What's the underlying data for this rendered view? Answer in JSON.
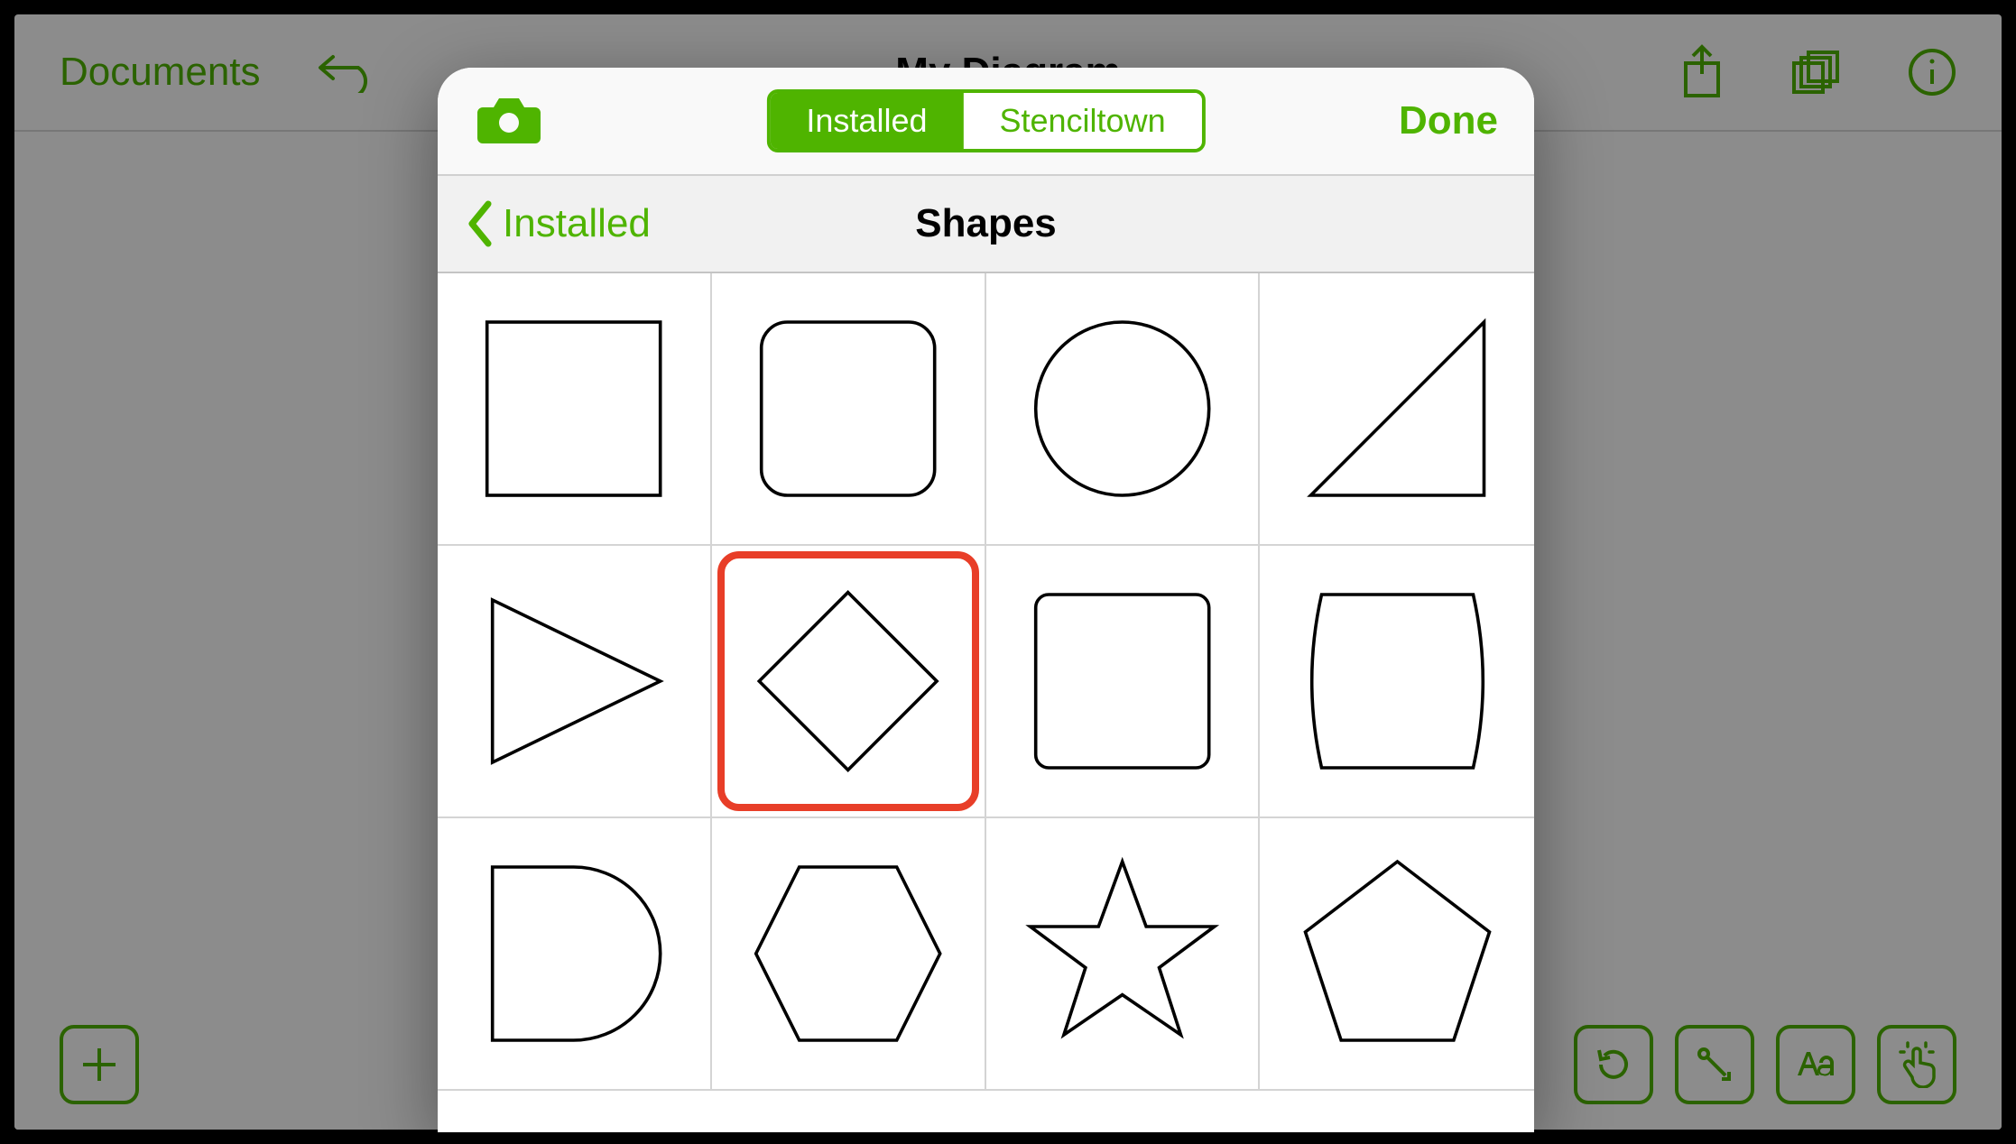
{
  "header": {
    "documents_label": "Documents",
    "document_title": "My Diagram"
  },
  "popover": {
    "segments": {
      "installed": "Installed",
      "stenciltown": "Stenciltown",
      "active": "installed"
    },
    "done_label": "Done",
    "back_label": "Installed",
    "title": "Shapes",
    "shapes": [
      {
        "name": "square"
      },
      {
        "name": "rounded-rectangle"
      },
      {
        "name": "circle"
      },
      {
        "name": "right-triangle"
      },
      {
        "name": "triangle-right"
      },
      {
        "name": "diamond",
        "highlighted": true
      },
      {
        "name": "rounded-square-large"
      },
      {
        "name": "barrel"
      },
      {
        "name": "d-shape"
      },
      {
        "name": "hexagon"
      },
      {
        "name": "star"
      },
      {
        "name": "pentagon"
      }
    ]
  },
  "toolbar": {
    "icons": [
      "share",
      "stack",
      "info"
    ],
    "bottom_left": [
      "add"
    ],
    "bottom_right": [
      "undo-circle",
      "connector",
      "text",
      "touch"
    ]
  },
  "colors": {
    "accent": "#4fb400",
    "highlight": "#e83e28"
  }
}
